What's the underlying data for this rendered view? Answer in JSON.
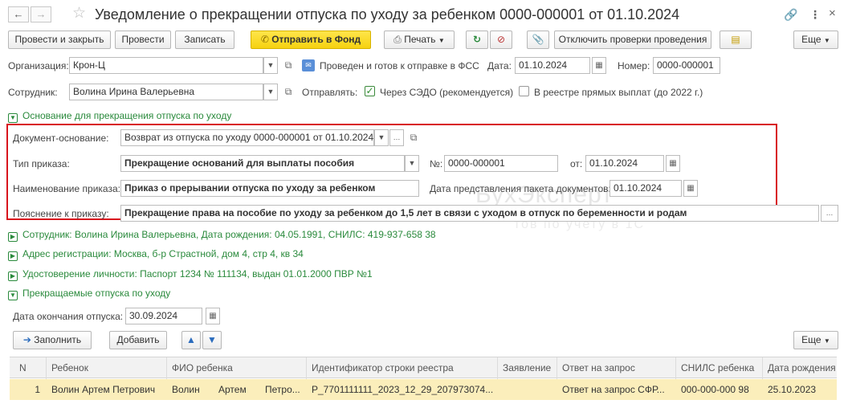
{
  "header": {
    "title": "Уведомление о прекращении отпуска по уходу за ребенком 0000-000001 от 01.10.2024",
    "back_icon": "←",
    "forward_icon": "→",
    "star_icon": "☆",
    "link_icon": "🔗",
    "more_icon": "⋮",
    "close_icon": "×"
  },
  "toolbar": {
    "post_close": "Провести и закрыть",
    "post": "Провести",
    "save": "Записать",
    "send_fund": "Отправить в Фонд",
    "print": "Печать",
    "disable_checks": "Отключить проверки проведения",
    "more": "Еще"
  },
  "org": {
    "label": "Организация:",
    "value": "Крон-Ц",
    "status": "Проведен и готов к отправке в ФСС",
    "date_label": "Дата:",
    "date": "01.10.2024",
    "number_label": "Номер:",
    "number": "0000-000001"
  },
  "employee": {
    "label": "Сотрудник:",
    "value": "Волина Ирина Валерьевна",
    "send_label": "Отправлять:",
    "sedo_label": "Через СЭДО (рекомендуется)",
    "registry_label": "В реестре прямых выплат (до 2022 г.)"
  },
  "basis": {
    "section": "Основание для прекращения отпуска по уходу",
    "doc_label": "Документ-основание:",
    "doc_value": "Возврат из отпуска по уходу 0000-000001 от 01.10.2024",
    "order_type_label": "Тип приказа:",
    "order_type_value": "Прекращение оснований для выплаты пособия",
    "num_label": "№:",
    "num_value": "0000-000001",
    "from_label": "от:",
    "from_value": "01.10.2024",
    "order_name_label": "Наименование приказа:",
    "order_name_value": "Приказ о прерывании отпуска по уходу за ребенком",
    "package_date_label": "Дата представления пакета документов:",
    "package_date_value": "01.10.2024",
    "explanation_label": "Пояснение к приказу:",
    "explanation_value": "Прекращение права на пособие по уходу за ребенком до 1,5 лет в связи с уходом в отпуск по беременности и родам",
    "watermark": "БухЭксперт",
    "watermark_sub": "тов по учету в 1С"
  },
  "sections": {
    "employee_info": "Сотрудник: Волина Ирина Валерьевна, Дата рождения: 04.05.1991, СНИЛС: 419-937-658 38",
    "address": "Адрес регистрации: Москва, б-р Страстной, дом 4, стр 4, кв 34",
    "identity": "Удостоверение личности: Паспорт 1234 № 111134, выдан 01.01.2000 ПВР №1",
    "leaves": "Прекращаемые отпуска по уходу"
  },
  "leave": {
    "end_label": "Дата окончания отпуска:",
    "end_value": "30.09.2024",
    "fill": "Заполнить",
    "add": "Добавить",
    "more": "Еще"
  },
  "table": {
    "columns": [
      "N",
      "Ребенок",
      "ФИО ребенка",
      "Идентификатор строки реестра",
      "Заявление",
      "Ответ на запрос",
      "СНИЛС ребенка",
      "Дата рождения"
    ],
    "rows": [
      {
        "n": "1",
        "child": "Волин Артем Петрович",
        "surname": "Волин",
        "name": "Артем",
        "patronymic": "Петро...",
        "registry_id": "P_7701111111_2023_12_29_207973074...",
        "statement": "",
        "response": "Ответ на запрос СФР...",
        "snils": "000-000-000 98",
        "birth": "25.10.2023"
      }
    ]
  },
  "colors": {
    "accent_green": "#2a8a3c",
    "highlight_red": "#d8141d",
    "button_yellow": "#f6d210",
    "row_selected": "#fbeebb"
  }
}
